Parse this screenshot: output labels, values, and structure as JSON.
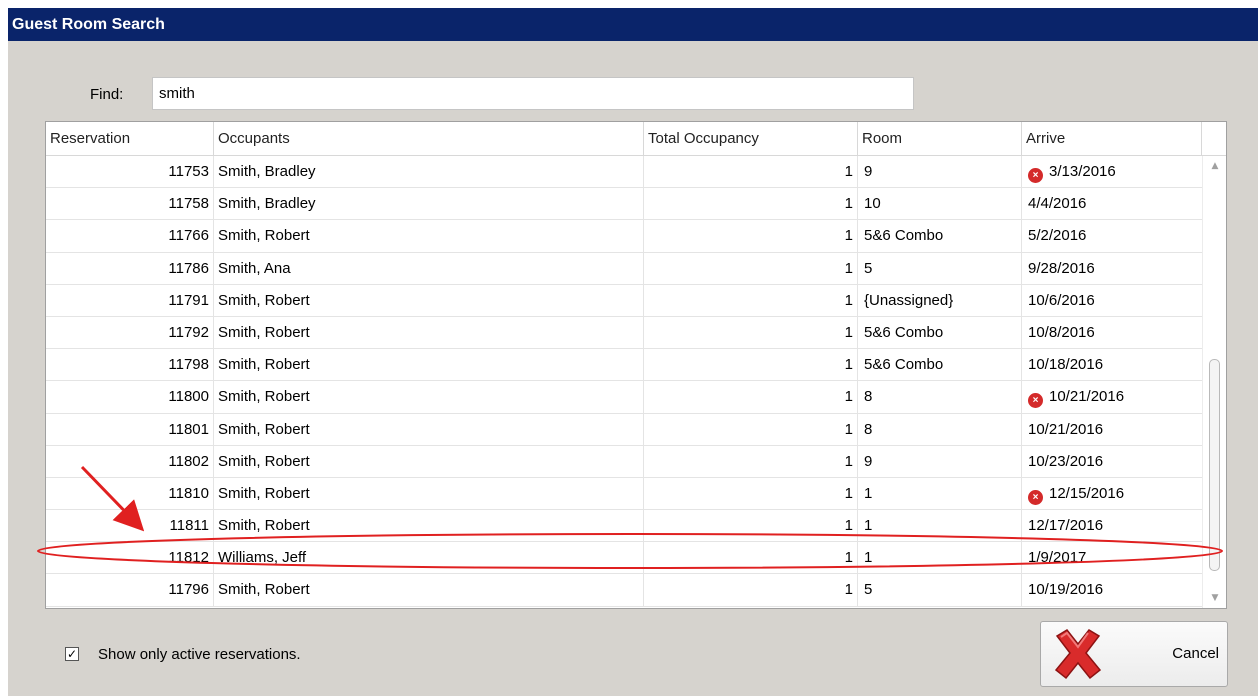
{
  "window": {
    "title": "Guest Room Search"
  },
  "search": {
    "label": "Find:",
    "value": "smith"
  },
  "table": {
    "columns": [
      "Reservation",
      "Occupants",
      "Total Occupancy",
      "Room",
      "Arrive"
    ],
    "rows": [
      {
        "reservation": "11753",
        "occupants": "Smith, Bradley",
        "total_occupancy": "1",
        "room": "9",
        "arrive": "3/13/2016",
        "warning": true
      },
      {
        "reservation": "11758",
        "occupants": "Smith, Bradley",
        "total_occupancy": "1",
        "room": "10",
        "arrive": "4/4/2016",
        "warning": false
      },
      {
        "reservation": "11766",
        "occupants": "Smith, Robert",
        "total_occupancy": "1",
        "room": "5&6 Combo",
        "arrive": "5/2/2016",
        "warning": false
      },
      {
        "reservation": "11786",
        "occupants": "Smith, Ana",
        "total_occupancy": "1",
        "room": "5",
        "arrive": "9/28/2016",
        "warning": false
      },
      {
        "reservation": "11791",
        "occupants": "Smith, Robert",
        "total_occupancy": "1",
        "room": "{Unassigned}",
        "arrive": "10/6/2016",
        "warning": false
      },
      {
        "reservation": "11792",
        "occupants": "Smith, Robert",
        "total_occupancy": "1",
        "room": "5&6 Combo",
        "arrive": "10/8/2016",
        "warning": false
      },
      {
        "reservation": "11798",
        "occupants": "Smith, Robert",
        "total_occupancy": "1",
        "room": "5&6 Combo",
        "arrive": "10/18/2016",
        "warning": false
      },
      {
        "reservation": "11800",
        "occupants": "Smith, Robert",
        "total_occupancy": "1",
        "room": "8",
        "arrive": "10/21/2016",
        "warning": true
      },
      {
        "reservation": "11801",
        "occupants": "Smith, Robert",
        "total_occupancy": "1",
        "room": "8",
        "arrive": "10/21/2016",
        "warning": false
      },
      {
        "reservation": "11802",
        "occupants": "Smith, Robert",
        "total_occupancy": "1",
        "room": "9",
        "arrive": "10/23/2016",
        "warning": false
      },
      {
        "reservation": "11810",
        "occupants": "Smith, Robert",
        "total_occupancy": "1",
        "room": "1",
        "arrive": "12/15/2016",
        "warning": true
      },
      {
        "reservation": "11811",
        "occupants": "Smith, Robert",
        "total_occupancy": "1",
        "room": "1",
        "arrive": "12/17/2016",
        "warning": false
      },
      {
        "reservation": "11812",
        "occupants": "Williams, Jeff",
        "total_occupancy": "1",
        "room": "1",
        "arrive": "1/9/2017",
        "warning": false
      },
      {
        "reservation": "11796",
        "occupants": "Smith, Robert",
        "total_occupancy": "1",
        "room": "5",
        "arrive": "10/19/2016",
        "warning": false
      }
    ]
  },
  "filter": {
    "label": "Show only active reservations.",
    "checked": true
  },
  "buttons": {
    "cancel_label": "Cancel"
  },
  "icons": {
    "warning": "error-x-circle-icon",
    "cancel": "red-x-icon",
    "checkbox_mark": "checkmark-icon"
  },
  "colors": {
    "titlebar": "#0a246a",
    "dialog_background": "#d6d3ce",
    "warning_icon": "#d42a2a",
    "annotation": "#e02020"
  }
}
